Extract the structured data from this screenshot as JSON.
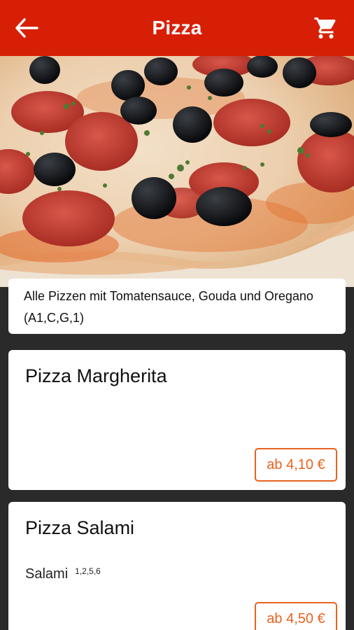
{
  "header": {
    "title": "Pizza",
    "back_icon": "arrow-left-icon",
    "cart_icon": "shopping-cart-icon",
    "color": "#d71f06"
  },
  "hero": {
    "image": "pizza-photo"
  },
  "info": {
    "text": "Alle Pizzen mit Tomatensauce, Gouda und Oregano (A1,C,G,1)"
  },
  "products": [
    {
      "name": "Pizza Margherita",
      "description": "",
      "allergens": "",
      "price": "ab 4,10 €"
    },
    {
      "name": "Pizza Salami",
      "description": "Salami",
      "allergens": "1,2,5,6",
      "price": "ab 4,50 €"
    }
  ],
  "colors": {
    "accent": "#e8631f",
    "background": "#2a2a2a"
  }
}
